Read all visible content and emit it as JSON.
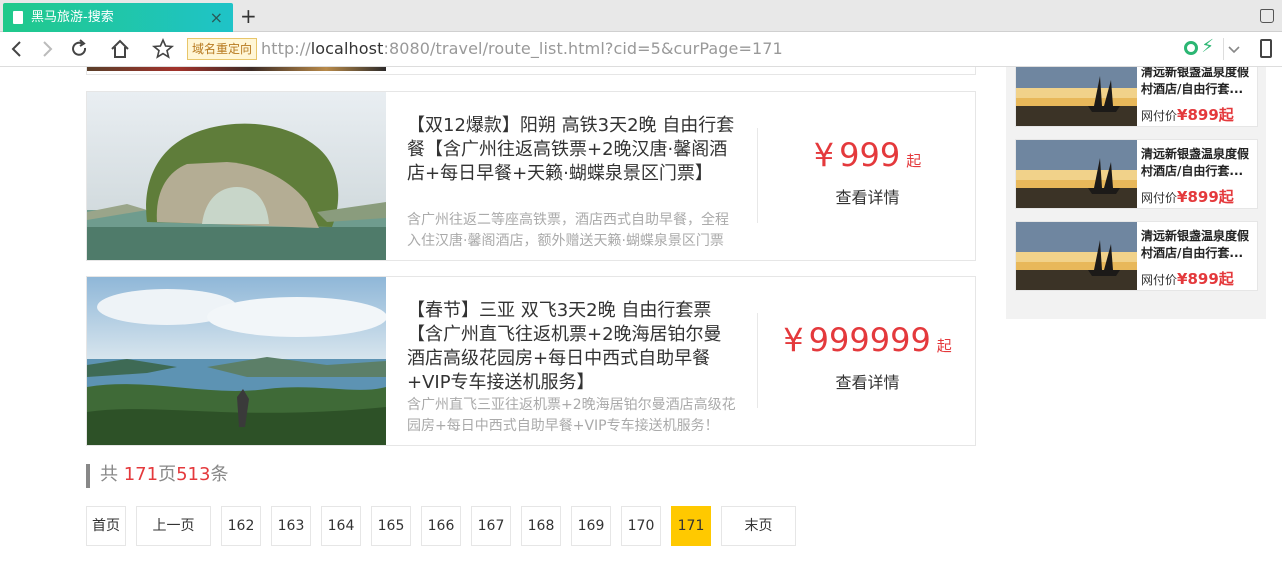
{
  "browser": {
    "tab_title": "黑马旅游-搜索",
    "tab_close": "×",
    "new_tab": "+",
    "redirect_badge": "域名重定向",
    "url_scheme": "http://",
    "url_host": "localhost",
    "url_rest": ":8080/travel/route_list.html?cid=5&curPage=171"
  },
  "routes": [
    {
      "title": "【双12爆款】阳朔 高铁3天2晚 自由行套餐【含广州往返高铁票+2晚汉唐·馨阁酒店+每日早餐+天籁·蝴蝶泉景区门票】",
      "desc": "含广州往返二等座高铁票，酒店西式自助早餐，全程入住汉唐·馨阁酒店，额外赠送天籁·蝴蝶泉景区门票一张！",
      "currency": "¥",
      "price": "999",
      "price_suffix": "起",
      "detail": "查看详情"
    },
    {
      "title": "【春节】三亚 双飞3天2晚 自由行套票【含广州直飞往返机票+2晚海居铂尔曼酒店高级花园房+每日中西式自助早餐+VIP专车接送机服务】",
      "desc": "含广州直飞三亚往返机票+2晚海居铂尔曼酒店高级花园房+每日中西式自助早餐+VIP专车接送机服务！",
      "currency": "¥",
      "price": "999999",
      "price_suffix": "起",
      "detail": "查看详情"
    }
  ],
  "summary": {
    "prefix": "共 ",
    "pages": "171",
    "pages_unit": "页",
    "count": "513",
    "count_unit": "条"
  },
  "pager": {
    "first": "首页",
    "prev": "上一页",
    "pages": [
      "162",
      "163",
      "164",
      "165",
      "166",
      "167",
      "168",
      "169",
      "170",
      "171"
    ],
    "active": "171",
    "last": "末页"
  },
  "sidebar": {
    "items": [
      {
        "name": "清远新银盏温泉度假村酒店/自由行套...",
        "price_label": "网付价",
        "price": "¥899起"
      },
      {
        "name": "清远新银盏温泉度假村酒店/自由行套...",
        "price_label": "网付价",
        "price": "¥899起"
      },
      {
        "name": "清远新银盏温泉度假村酒店/自由行套...",
        "price_label": "网付价",
        "price": "¥899起"
      }
    ]
  },
  "colors": {
    "tab_gradient_start": "#20c98a",
    "tab_gradient_end": "#1fc3c8",
    "price_red": "#e4393c",
    "active_page": "#ffc900"
  },
  "icons": [
    "file-icon",
    "close-icon",
    "plus-icon",
    "shirt-icon",
    "back-icon",
    "forward-icon",
    "reload-icon",
    "home-icon",
    "star-icon",
    "extension-icon",
    "bolt-icon",
    "chevron-down-icon",
    "phone-icon"
  ]
}
